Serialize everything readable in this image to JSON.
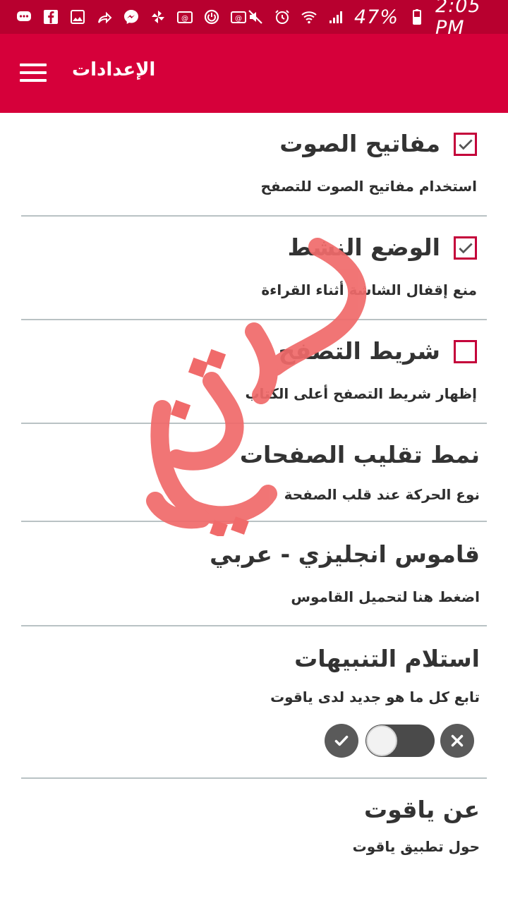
{
  "status_bar": {
    "battery": "47%",
    "time": "2:05 PM",
    "left_icons": [
      "chat-bubble-icon",
      "facebook-icon",
      "gallery-icon",
      "share-arrow-icon",
      "messenger-icon",
      "pinwheel-icon",
      "email-icon",
      "power-icon",
      "email-icon"
    ],
    "right_icons": [
      "mute-icon",
      "alarm-icon",
      "wifi-icon",
      "signal-icon",
      "battery-icon"
    ]
  },
  "app_bar": {
    "title": "الإعدادات",
    "menu_icon": "hamburger-menu-icon"
  },
  "settings": [
    {
      "title": "مفاتيح الصوت",
      "subtitle": "استخدام مفاتيح الصوت للتصفح",
      "checkbox": true
    },
    {
      "title": "الوضع النشط",
      "subtitle": "منع إقفال الشاشة أثناء القراءة",
      "checkbox": true
    },
    {
      "title": "شريط التصفح",
      "subtitle": "إظهار شريط التصفح أعلى الكتاب",
      "checkbox": false
    },
    {
      "title": "نمط تقليب الصفحات",
      "subtitle": "نوع الحركة عند قلب الصفحة"
    },
    {
      "title": "قاموس انجليزي - عربي",
      "subtitle": "اضغط هنا لتحميل القاموس"
    },
    {
      "title": "استلام التنبيهات",
      "subtitle": "تابع كل ما هو جديد لدى ياقوت",
      "toggle": "off"
    },
    {
      "title": "عن ياقوت",
      "subtitle": "حول تطبيق ياقوت"
    }
  ],
  "colors": {
    "status_bar": "#b8002f",
    "app_bar": "#d6003a",
    "checkbox_border": "#c4003a",
    "divider": "#b9c2c4",
    "watermark": "#f06a6a"
  }
}
